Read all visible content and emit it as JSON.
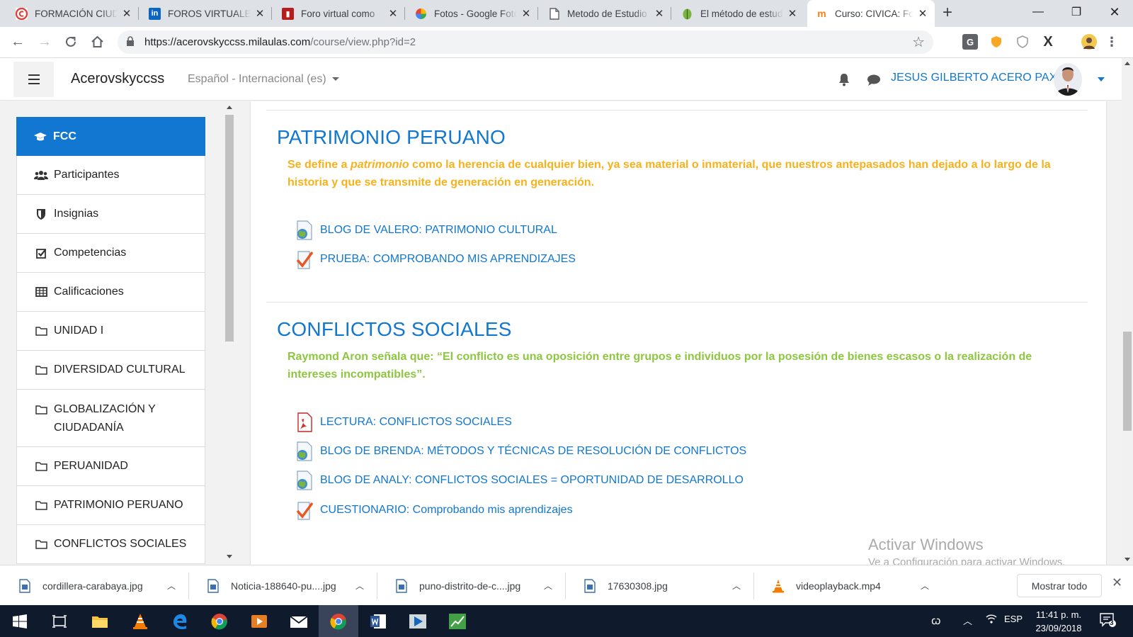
{
  "browser": {
    "tabs": [
      {
        "title": "FORMACIÓN CIUDADANA",
        "icon": "red-circle-c-icon"
      },
      {
        "title": "FOROS VIRTUALES",
        "icon": "linkedin-icon"
      },
      {
        "title": "Foro virtual como",
        "icon": "slideshare-icon"
      },
      {
        "title": "Fotos - Google Fotos",
        "icon": "google-photos-icon"
      },
      {
        "title": "Metodo de Estudio",
        "icon": "document-icon"
      },
      {
        "title": "El método de estudio",
        "icon": "leaf-icon"
      },
      {
        "title": "Curso: CIVICA: Formación",
        "icon": "moodle-icon"
      }
    ],
    "url_host": "https://acerovskyccss.milaulas.com",
    "url_path": "/course/view.php?id=2"
  },
  "navbar": {
    "site_name": "Acerovskyccss",
    "language": "Español - Internacional (es)",
    "user_name": "JESUS GILBERTO ACERO PAXI"
  },
  "sidebar": {
    "items": [
      {
        "label": "FCC",
        "icon": "graduation-cap-icon"
      },
      {
        "label": "Participantes",
        "icon": "users-icon"
      },
      {
        "label": "Insignias",
        "icon": "shield-icon"
      },
      {
        "label": "Competencias",
        "icon": "check-square-icon"
      },
      {
        "label": "Calificaciones",
        "icon": "table-icon"
      },
      {
        "label": "UNIDAD I",
        "icon": "folder-icon"
      },
      {
        "label": "DIVERSIDAD CULTURAL",
        "icon": "folder-icon"
      },
      {
        "label": "GLOBALIZACIÓN Y CIUDADANÍA",
        "icon": "folder-icon"
      },
      {
        "label": "PERUANIDAD",
        "icon": "folder-icon"
      },
      {
        "label": "PATRIMONIO PERUANO",
        "icon": "folder-icon"
      },
      {
        "label": "CONFLICTOS SOCIALES",
        "icon": "folder-icon"
      }
    ]
  },
  "sections": [
    {
      "title": "PATRIMONIO PERUANO",
      "summary_before": "Se define a ",
      "summary_em": "patrimonio",
      "summary_after": " como la herencia de cualquier bien, ya sea material o inmaterial, que nuestros antepasados han dejado a lo largo de la historia y que se transmite de generación en generación.",
      "summary_color": "#f7b11b",
      "activities": [
        {
          "label": "BLOG DE VALERO: PATRIMONIO CULTURAL",
          "icon": "url-globe-icon"
        },
        {
          "label": "PRUEBA: COMPROBANDO MIS APRENDIZAJES",
          "icon": "quiz-check-icon"
        }
      ]
    },
    {
      "title": "CONFLICTOS SOCIALES",
      "summary": "Raymond Aron señala que: “El conflicto es una oposición entre grupos e individuos por la posesión de bienes escasos o la realización de intereses incompatibles”.",
      "summary_color": "#8dc63f",
      "activities": [
        {
          "label": "LECTURA: CONFLICTOS SOCIALES",
          "icon": "pdf-icon"
        },
        {
          "label": "BLOG DE BRENDA: MÉTODOS Y TÉCNICAS DE RESOLUCIÓN DE CONFLICTOS",
          "icon": "url-globe-icon"
        },
        {
          "label": "BLOG DE ANALY: CONFLICTOS SOCIALES = OPORTUNIDAD DE DESARROLLO",
          "icon": "url-globe-icon"
        },
        {
          "label": "CUESTIONARIO: Comprobando mis aprendizajes",
          "icon": "quiz-check-icon"
        }
      ]
    }
  ],
  "watermark": {
    "line1": "Activar Windows",
    "line2": "Ve a Configuración para activar Windows."
  },
  "downloads": {
    "items": [
      {
        "name": "cordillera-carabaya.jpg",
        "icon": "image-file-icon"
      },
      {
        "name": "Noticia-188640-pu....jpg",
        "icon": "image-file-icon"
      },
      {
        "name": "puno-distrito-de-c....jpg",
        "icon": "image-file-icon"
      },
      {
        "name": "17630308.jpg",
        "icon": "image-file-icon"
      },
      {
        "name": "videoplayback.mp4",
        "icon": "vlc-icon"
      }
    ],
    "show_all": "Mostrar todo"
  },
  "taskbar": {
    "language": "ESP",
    "time": "11:41 p. m.",
    "date": "23/09/2018",
    "notifications": "3"
  },
  "colors": {
    "accent": "#1177d1",
    "patrimonio_text": "#f7b11b",
    "conflictos_text": "#8dc63f"
  }
}
